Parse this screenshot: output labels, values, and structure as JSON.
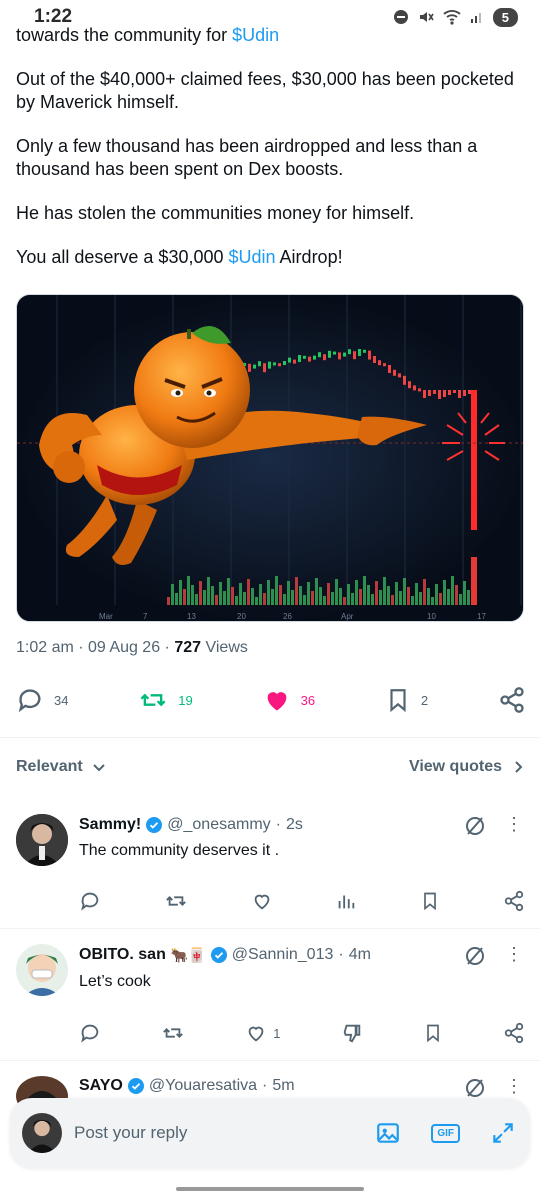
{
  "status_bar": {
    "time": "1:22",
    "battery": "5"
  },
  "post": {
    "paragraphs": [
      {
        "before": "towards the community for ",
        "link": "$Udin",
        "after": ""
      },
      {
        "before": "Out of the $40,000+ claimed fees, $30,000 has been pocketed by Maverick himself.",
        "link": "",
        "after": ""
      },
      {
        "before": "Only a few thousand has been airdropped and less than a thousand has been spent on Dex boosts.",
        "link": "",
        "after": ""
      },
      {
        "before": "He has stolen the communities money for himself.",
        "link": "",
        "after": ""
      },
      {
        "before": "You all deserve a $30,000 ",
        "link": "$Udin",
        "after": " Airdrop!"
      }
    ],
    "media_axis_labels": [
      "Mar",
      "7",
      "13",
      "20",
      "26",
      "Apr",
      "10",
      "17"
    ],
    "time": "1:02 am",
    "date": "09 Aug 26",
    "views_count": "727",
    "views_label": "Views",
    "stats": {
      "replies": "34",
      "reposts": "19",
      "likes": "36",
      "bookmarks": "2"
    }
  },
  "sort": {
    "label": "Relevant",
    "view_quotes": "View quotes"
  },
  "replies": [
    {
      "name": "Sammy!",
      "badge": "",
      "handle": "@_onesammy",
      "time": "2s",
      "text": "The community deserves it .",
      "likes": "",
      "variant": "views"
    },
    {
      "name": "OBITO. san",
      "badge": "🐂🀄",
      "handle": "@Sannin_013",
      "time": "4m",
      "text": "Let’s cook",
      "likes": "1",
      "variant": "dislike"
    },
    {
      "name": "SAYO",
      "badge": "",
      "handle": "@Youaresativa",
      "time": "5m",
      "text": "",
      "likes": "",
      "variant": ""
    }
  ],
  "composer": {
    "placeholder": "Post your reply",
    "gif_label": "GIF"
  },
  "colors": {
    "link": "#1d9bf0",
    "repost": "#00ba7c",
    "like": "#f91880",
    "muted": "#536471"
  }
}
